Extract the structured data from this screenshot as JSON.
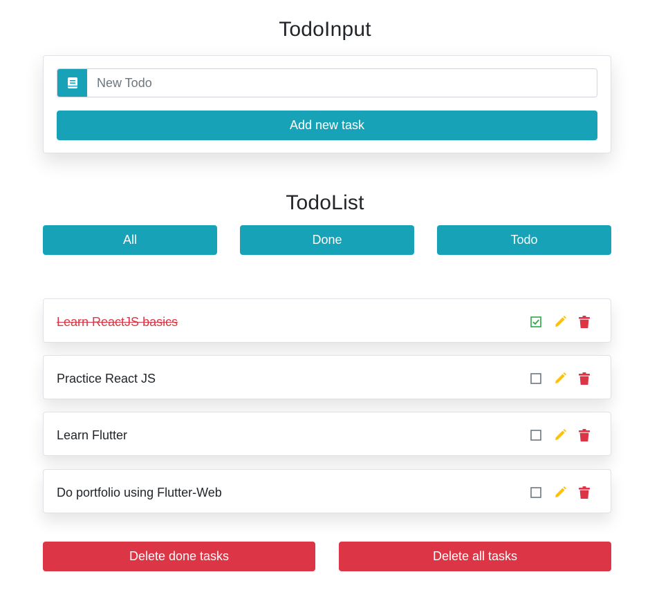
{
  "todo_input": {
    "title": "TodoInput",
    "placeholder": "New Todo",
    "value": "",
    "add_button_label": "Add new task",
    "prepend_icon": "book-icon"
  },
  "todo_list": {
    "title": "TodoList",
    "filters": [
      {
        "label": "All"
      },
      {
        "label": "Done"
      },
      {
        "label": "Todo"
      }
    ],
    "items": [
      {
        "text": "Learn ReactJS basics",
        "done": true
      },
      {
        "text": "Practice React JS",
        "done": false
      },
      {
        "text": "Learn Flutter",
        "done": false
      },
      {
        "text": "Do portfolio using Flutter-Web",
        "done": false
      }
    ]
  },
  "footer": {
    "delete_done_label": "Delete done tasks",
    "delete_all_label": "Delete all tasks"
  },
  "colors": {
    "info": "#17a2b8",
    "danger": "#dc3545",
    "success": "#28a745",
    "warning": "#ffc107",
    "muted": "#6c757d"
  }
}
